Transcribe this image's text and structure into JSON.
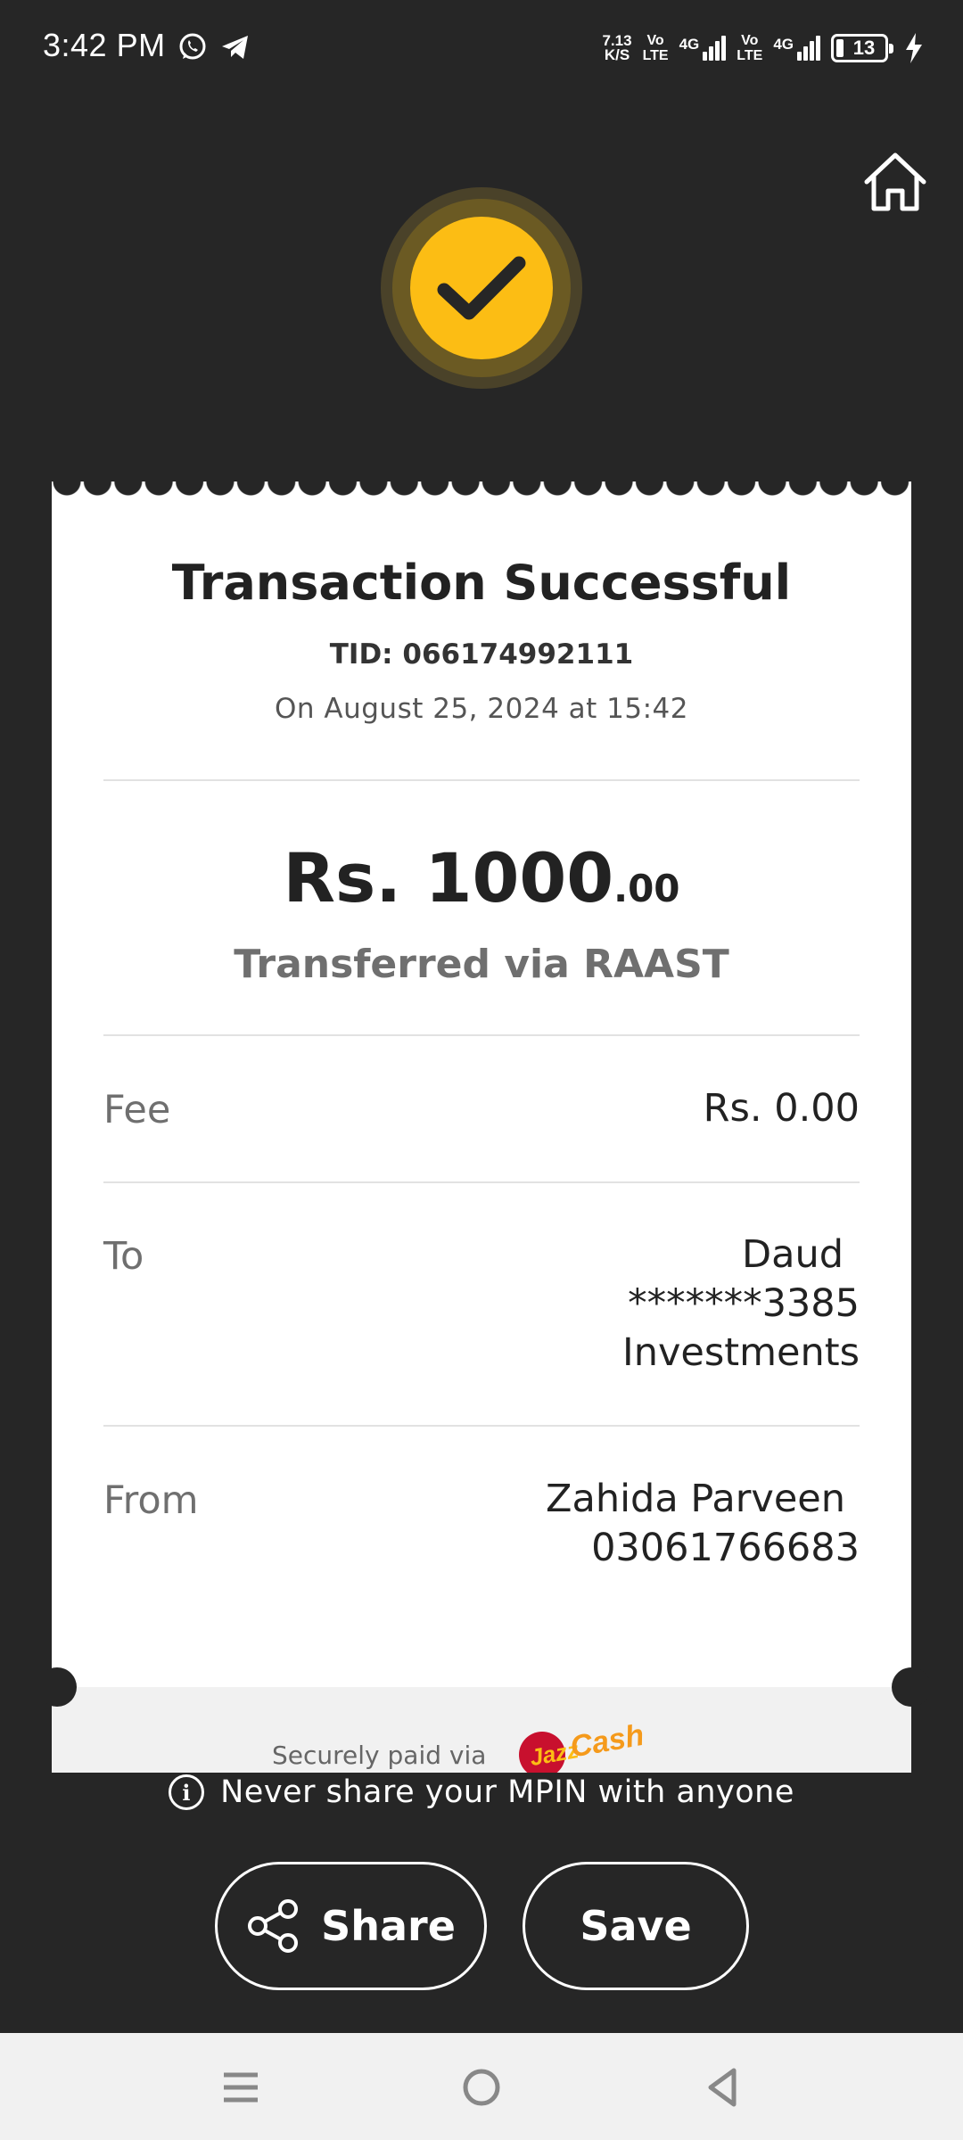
{
  "status_bar": {
    "time": "3:42 PM",
    "net_speed_value": "7.13",
    "net_speed_unit": "K/S",
    "sim1_tag_top": "Vo",
    "sim1_tag_bottom": "LTE",
    "sim1_network": "4G",
    "sim2_tag_top": "Vo",
    "sim2_tag_bottom": "LTE",
    "sim2_network": "4G",
    "battery_level": "13",
    "icons": [
      "whatsapp-icon",
      "telegram-icon",
      "signal-icon",
      "battery-icon",
      "charging-icon"
    ]
  },
  "header": {
    "home_icon": "home-icon",
    "status_icon": "checkmark-icon",
    "accent_color": "#fcbd14"
  },
  "receipt": {
    "title": "Transaction Successful",
    "tid": "TID: 066174992111",
    "datetime": "On August 25, 2024 at 15:42",
    "amount_main": "Rs. 1000",
    "amount_cents": ".00",
    "method": "Transferred via RAAST",
    "fee_label": "Fee",
    "fee_value": "Rs. 0.00",
    "to_label": "To",
    "to_name": "Daud",
    "to_account": "*******3385",
    "to_bank": "Investments",
    "from_label": "From",
    "from_name": "Zahida Parveen",
    "from_number": "03061766683",
    "securely_paid": "Securely paid via",
    "logo_text_1": "Jazz",
    "logo_text_2": "Cash"
  },
  "footer": {
    "mpin_note": "Never share your MPIN with anyone",
    "share_label": "Share",
    "save_label": "Save"
  },
  "nav": {
    "icons": [
      "menu-icon",
      "home-circle-icon",
      "back-icon"
    ]
  }
}
